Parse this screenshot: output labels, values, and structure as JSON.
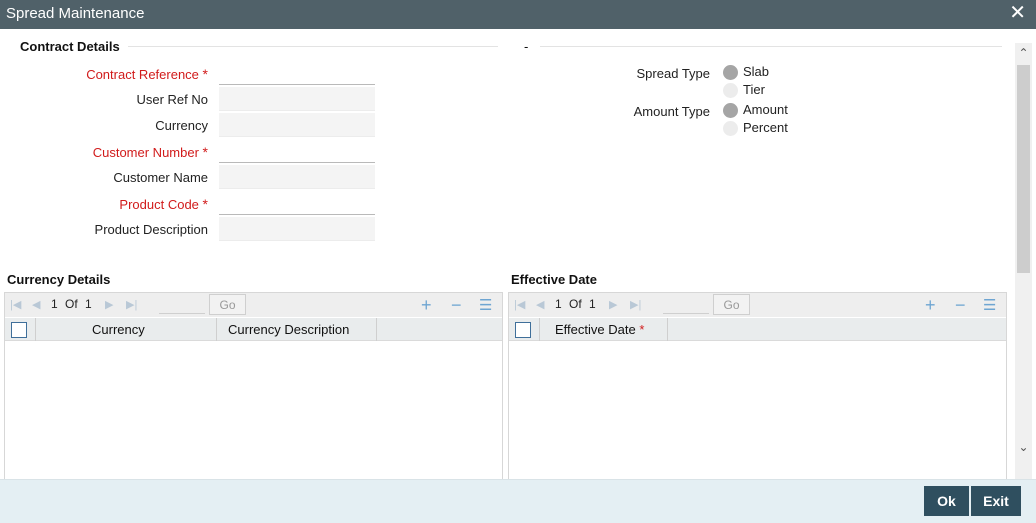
{
  "window": {
    "title": "Spread Maintenance",
    "close_glyph": "✕"
  },
  "contract_details": {
    "heading": "Contract Details",
    "right_heading": "-",
    "fields": {
      "contract_reference": {
        "label": "Contract Reference",
        "value": ""
      },
      "user_ref_no": {
        "label": "User Ref No",
        "value": ""
      },
      "currency": {
        "label": "Currency",
        "value": ""
      },
      "customer_number": {
        "label": "Customer Number",
        "value": ""
      },
      "customer_name": {
        "label": "Customer Name",
        "value": ""
      },
      "product_code": {
        "label": "Product Code",
        "value": ""
      },
      "product_description": {
        "label": "Product Description",
        "value": ""
      }
    },
    "required_star": "*",
    "spread_type": {
      "label": "Spread Type",
      "options": [
        "Slab",
        "Tier"
      ],
      "selected": "Slab"
    },
    "amount_type": {
      "label": "Amount Type",
      "options": [
        "Amount",
        "Percent"
      ],
      "selected": "Amount"
    }
  },
  "currency_details": {
    "heading": "Currency Details",
    "pager": {
      "current": "1",
      "of_label": "Of",
      "total": "1"
    },
    "go_label": "Go",
    "columns": [
      "Currency",
      "Currency Description"
    ],
    "rows": []
  },
  "effective_date": {
    "heading": "Effective Date",
    "pager": {
      "current": "1",
      "of_label": "Of",
      "total": "1"
    },
    "go_label": "Go",
    "columns": [
      "Effective Date"
    ],
    "required_star": "*",
    "rows": []
  },
  "footer": {
    "ok_label": "Ok",
    "exit_label": "Exit"
  },
  "colors": {
    "titlebar": "#506169",
    "required": "#d11b1b",
    "button": "#2f4f5f",
    "footer": "#e4eff3"
  },
  "icons": [
    "close-icon",
    "first-page-icon",
    "prev-page-icon",
    "next-page-icon",
    "last-page-icon",
    "add-row-icon",
    "delete-row-icon",
    "single-view-icon",
    "scroll-up-icon",
    "scroll-down-icon"
  ]
}
